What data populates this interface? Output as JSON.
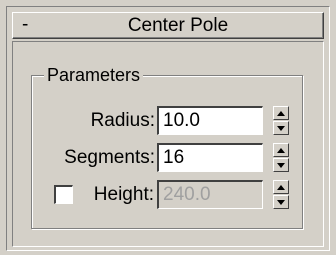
{
  "rollout": {
    "collapse_symbol": "-",
    "title": "Center Pole"
  },
  "parameters": {
    "group_label": "Parameters",
    "radius": {
      "label": "Radius:",
      "value": "10.0"
    },
    "segments": {
      "label": "Segments:",
      "value": "16"
    },
    "height": {
      "label": "Height:",
      "value": "240.0",
      "checked": false,
      "enabled": false
    }
  }
}
